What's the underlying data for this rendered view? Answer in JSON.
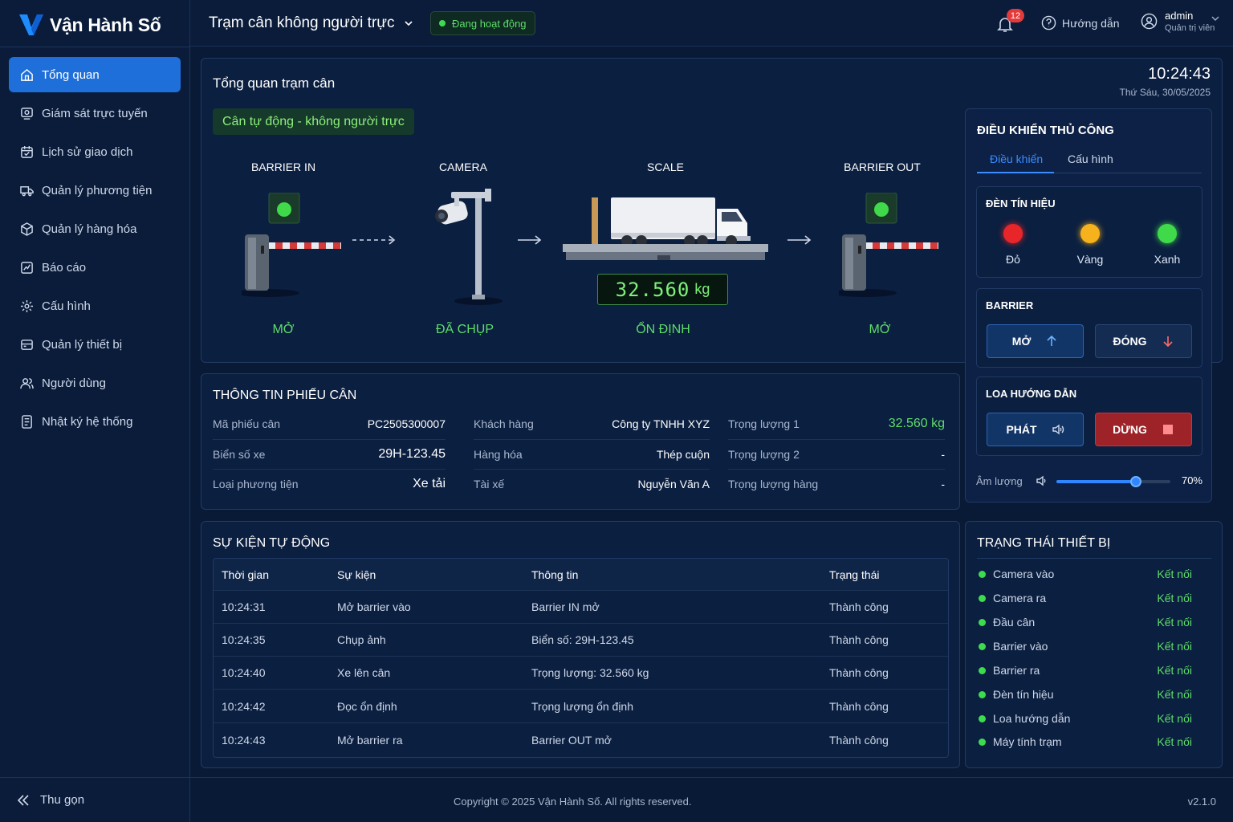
{
  "app": {
    "name": "Vận Hành Số"
  },
  "sidebar": {
    "items": [
      {
        "label": "Tổng quan",
        "icon": "home-icon"
      },
      {
        "label": "Giám sát trực tuyến",
        "icon": "monitor-icon"
      },
      {
        "label": "Lịch sử giao dịch",
        "icon": "calendar-icon"
      },
      {
        "label": "Quản lý phương tiện",
        "icon": "truck-icon"
      },
      {
        "label": "Quản lý hàng hóa",
        "icon": "box-icon"
      },
      {
        "label": "Báo cáo",
        "icon": "chart-icon"
      },
      {
        "label": "Cấu hình",
        "icon": "gear-icon"
      },
      {
        "label": "Quản lý thiết bị",
        "icon": "device-icon"
      },
      {
        "label": "Người dùng",
        "icon": "users-icon"
      },
      {
        "label": "Nhật ký hệ thống",
        "icon": "log-icon"
      }
    ],
    "collapse_label": "Thu gọn"
  },
  "header": {
    "station": "Trạm cân không người trực",
    "status": "Đang hoạt động",
    "notifications": "12",
    "help": "Hướng dẫn",
    "user_name": "admin",
    "user_role": "Quản trị viên"
  },
  "overview": {
    "title": "Tổng quan trạm cân",
    "mode": "Cân tự động - không người trực",
    "time": "10:24:43",
    "date": "Thứ Sáu, 30/05/2025",
    "stages": [
      {
        "label": "BARRIER IN",
        "state": "MỞ"
      },
      {
        "label": "CAMERA",
        "state": "ĐÃ CHỤP"
      },
      {
        "label": "SCALE",
        "state": "ỔN ĐỊNH"
      },
      {
        "label": "BARRIER OUT",
        "state": "MỞ"
      }
    ],
    "weight": "32.560",
    "weight_unit": "kg"
  },
  "manual": {
    "title": "ĐIỀU KHIỂN THỦ CÔNG",
    "tabs": [
      "Điều khiển",
      "Cấu hình"
    ],
    "signal_title": "ĐÈN TÍN HIỆU",
    "lights": [
      {
        "name": "Đỏ",
        "color": "#e8262a"
      },
      {
        "name": "Vàng",
        "color": "#f5b21c"
      },
      {
        "name": "Xanh",
        "color": "#3fd94a"
      }
    ],
    "barrier_title": "BARRIER",
    "open_label": "MỞ",
    "close_label": "ĐÓNG",
    "speaker_title": "LOA HƯỚNG DẪN",
    "play_label": "PHÁT",
    "stop_label": "DỪNG",
    "volume_label": "Âm lượng",
    "volume_value": "70%",
    "volume_fraction": 0.7
  },
  "ticket": {
    "title": "THÔNG TIN PHIẾU CÂN",
    "col1": [
      {
        "k": "Mã phiếu cân",
        "v": "PC2505300007"
      },
      {
        "k": "Biển số xe",
        "v": "29H-123.45"
      },
      {
        "k": "Loại phương tiện",
        "v": "Xe tải"
      }
    ],
    "col2": [
      {
        "k": "Khách hàng",
        "v": "Công ty TNHH XYZ"
      },
      {
        "k": "Hàng hóa",
        "v": "Thép cuộn"
      },
      {
        "k": "Tài xế",
        "v": "Nguyễn Văn A"
      }
    ],
    "col3": [
      {
        "k": "Trọng lượng 1",
        "v": "32.560 kg"
      },
      {
        "k": "Trọng lượng 2",
        "v": "-"
      },
      {
        "k": "Trọng lượng hàng",
        "v": "-"
      }
    ]
  },
  "events": {
    "title": "SỰ KIỆN TỰ ĐỘNG",
    "headers": [
      "Thời gian",
      "Sự kiện",
      "Thông tin",
      "Trạng thái"
    ],
    "rows": [
      [
        "10:24:31",
        "Mở barrier vào",
        "Barrier IN mở",
        "Thành công"
      ],
      [
        "10:24:35",
        "Chụp ảnh",
        "Biển số: 29H-123.45",
        "Thành công"
      ],
      [
        "10:24:40",
        "Xe lên cân",
        "Trọng lượng: 32.560 kg",
        "Thành công"
      ],
      [
        "10:24:42",
        "Đọc ổn định",
        "Trọng lượng ổn định",
        "Thành công"
      ],
      [
        "10:24:43",
        "Mở barrier ra",
        "Barrier OUT mở",
        "Thành công"
      ]
    ]
  },
  "devices": {
    "title": "TRẠNG THÁI THIẾT BỊ",
    "items": [
      {
        "name": "Camera vào",
        "status": "Kết nối"
      },
      {
        "name": "Camera ra",
        "status": "Kết nối"
      },
      {
        "name": "Đầu cân",
        "status": "Kết nối"
      },
      {
        "name": "Barrier vào",
        "status": "Kết nối"
      },
      {
        "name": "Barrier ra",
        "status": "Kết nối"
      },
      {
        "name": "Đèn tín hiệu",
        "status": "Kết nối"
      },
      {
        "name": "Loa hướng dẫn",
        "status": "Kết nối"
      },
      {
        "name": "Máy tính trạm",
        "status": "Kết nối"
      }
    ]
  },
  "footer": {
    "copyright": "Copyright © 2025 Vận Hành Số. All rights reserved.",
    "version": "v2.1.0"
  },
  "colors": {
    "accent": "#1e6fd9",
    "success": "#5fdc6a",
    "danger": "#9d2328"
  }
}
